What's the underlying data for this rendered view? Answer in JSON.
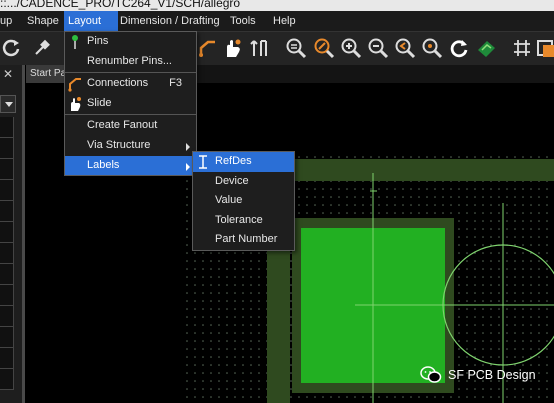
{
  "title": "::.../CADENCE_PRO/TC264_V1/SCH/allegro",
  "menubar": [
    {
      "label": "up"
    },
    {
      "label": "Shape"
    },
    {
      "label": "Layout"
    },
    {
      "label": "Dimension / Drafting"
    },
    {
      "label": "Tools"
    },
    {
      "label": "Help"
    }
  ],
  "tab": {
    "label": "Start Pa"
  },
  "layout_menu": [
    {
      "label": "Pins",
      "shortcut": "",
      "icon": "pin-icon"
    },
    {
      "label": "Renumber Pins...",
      "shortcut": "",
      "icon": ""
    },
    {
      "label": "Connections",
      "shortcut": "F3",
      "icon": "connections-icon"
    },
    {
      "label": "Slide",
      "shortcut": "",
      "icon": "slide-icon"
    },
    {
      "label": "Create Fanout",
      "shortcut": "",
      "icon": ""
    },
    {
      "label": "Via Structure",
      "shortcut": "",
      "icon": "",
      "submenu": true
    },
    {
      "label": "Labels",
      "shortcut": "",
      "icon": "",
      "submenu": true,
      "highlighted": true
    }
  ],
  "labels_submenu": [
    {
      "label": "RefDes",
      "highlighted": true,
      "icon": "text-cursor-icon"
    },
    {
      "label": "Device"
    },
    {
      "label": "Value"
    },
    {
      "label": "Tolerance"
    },
    {
      "label": "Part Number"
    }
  ],
  "watermark": {
    "text": "SF PCB Design",
    "icon": "wechat-icon"
  },
  "colors": {
    "accent": "#2b6fd6",
    "pad_green": "#22b022",
    "board_dark_green": "#2f4a1f",
    "outline_green": "#7fd36e"
  }
}
